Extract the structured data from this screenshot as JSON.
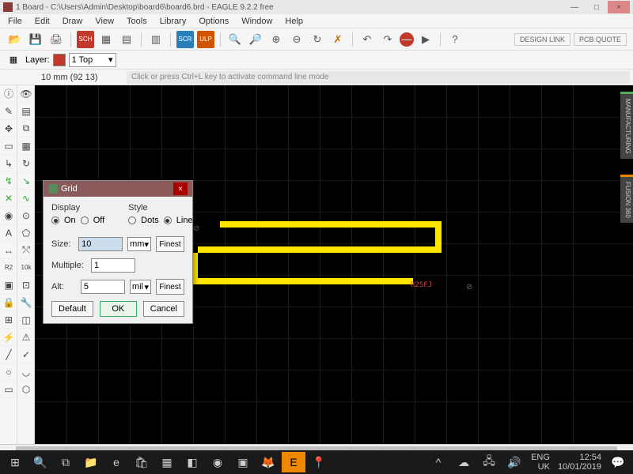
{
  "window": {
    "title": "1 Board - C:\\Users\\Admin\\Desktop\\board6\\board6.brd - EAGLE 9.2.2 free",
    "min": "—",
    "max": "□",
    "close": "×"
  },
  "menu": [
    "File",
    "Edit",
    "Draw",
    "View",
    "Tools",
    "Library",
    "Options",
    "Window",
    "Help"
  ],
  "layer": {
    "label": "Layer:",
    "value": "1 Top"
  },
  "status": {
    "coord": "10 mm (92 13)",
    "hint": "Click or press Ctrl+L key to activate command line mode"
  },
  "rightTabs": [
    "MANUFACTURING",
    "FUSION 360"
  ],
  "canvasLabel": "R2SFJ",
  "designLink": "DESIGN LINK",
  "pcbQuote": "PCB QUOTE",
  "dialog": {
    "title": "Grid",
    "display": "Display",
    "style": "Style",
    "on": "On",
    "off": "Off",
    "dots": "Dots",
    "lines": "Lines",
    "size": "Size:",
    "sizeVal": "10",
    "sizeUnit": "mm",
    "finest": "Finest",
    "multiple": "Multiple:",
    "multVal": "1",
    "alt": "Alt:",
    "altVal": "5",
    "altUnit": "mil",
    "default": "Default",
    "ok": "OK",
    "cancel": "Cancel"
  },
  "taskbar": {
    "lang": "ENG",
    "locale": "UK",
    "time": "12:54",
    "date": "10/01/2019"
  }
}
